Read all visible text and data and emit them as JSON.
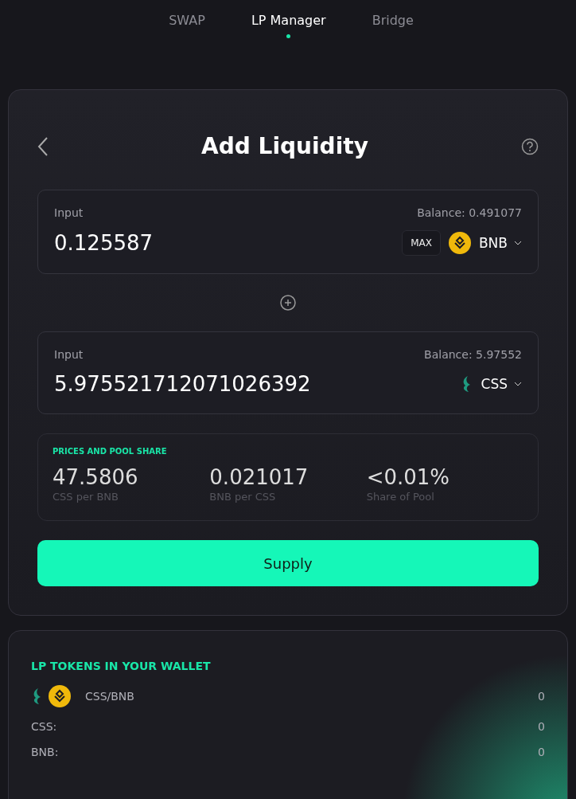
{
  "tabs": [
    {
      "label": "SWAP",
      "selected": false
    },
    {
      "label": "LP Manager",
      "selected": true
    },
    {
      "label": "Bridge",
      "selected": false
    }
  ],
  "card": {
    "title": "Add Liquidity",
    "inputs": [
      {
        "label": "Input",
        "balance": "Balance: 0.491077",
        "value": "0.125587",
        "max": "MAX",
        "token": "BNB",
        "kind": "bnb"
      },
      {
        "label": "Input",
        "balance": "Balance: 5.97552",
        "value": "5.975521712071026392",
        "token": "CSS",
        "kind": "css"
      }
    ],
    "prices": {
      "heading": "PRICES AND POOL SHARE",
      "items": [
        {
          "value": "47.5806",
          "caption": "CSS per BNB"
        },
        {
          "value": "0.021017",
          "caption": "BNB per CSS"
        },
        {
          "value": "<0.01%",
          "caption": "Share of Pool"
        }
      ]
    },
    "supply": "Supply"
  },
  "wallet": {
    "heading": "LP TOKENS IN YOUR WALLET",
    "pair": "CSS/BNB",
    "pair_amount": "0",
    "rows": [
      {
        "label": "CSS:",
        "amount": "0"
      },
      {
        "label": "BNB:",
        "amount": "0"
      }
    ]
  }
}
